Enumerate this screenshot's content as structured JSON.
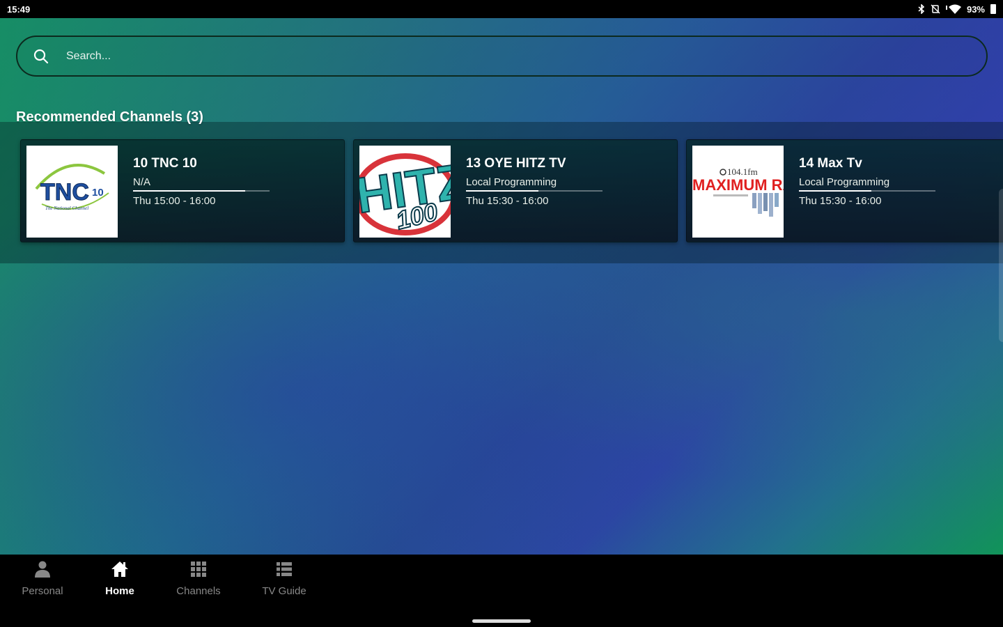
{
  "status_bar": {
    "time": "15:49",
    "battery": "93%",
    "icons": [
      "bluetooth-icon",
      "mute-icon",
      "wifi-icon",
      "battery-icon"
    ]
  },
  "search": {
    "placeholder": "Search..."
  },
  "recommended": {
    "title": "Recommended Channels (3)",
    "channels": [
      {
        "title": "10 TNC 10",
        "program": "N/A",
        "time": "Thu 15:00 - 16:00",
        "progress": 0.82,
        "logo": "TNC",
        "logo_tagline": "The National Channel"
      },
      {
        "title": "13 OYE HITZ TV",
        "program": "Local Programming",
        "time": "Thu 15:30 - 16:00",
        "progress": 0.53,
        "logo": "HITZ",
        "logo_sub": "100"
      },
      {
        "title": "14 Max Tv",
        "program": "Local Programming",
        "time": "Thu 15:30 - 16:00",
        "progress": 0.53,
        "logo": "MAXIMUM RA",
        "logo_freq": "104.1fm"
      }
    ]
  },
  "nav": {
    "items": [
      {
        "label": "Personal",
        "icon": "person-icon"
      },
      {
        "label": "Home",
        "icon": "home-icon",
        "active": true
      },
      {
        "label": "Channels",
        "icon": "grid-icon"
      },
      {
        "label": "TV Guide",
        "icon": "list-icon"
      }
    ]
  },
  "colors": {
    "gradient_green": "#0da84e",
    "gradient_blue": "#2a4aa0",
    "nav_bg": "#000000",
    "nav_inactive": "#888888"
  }
}
